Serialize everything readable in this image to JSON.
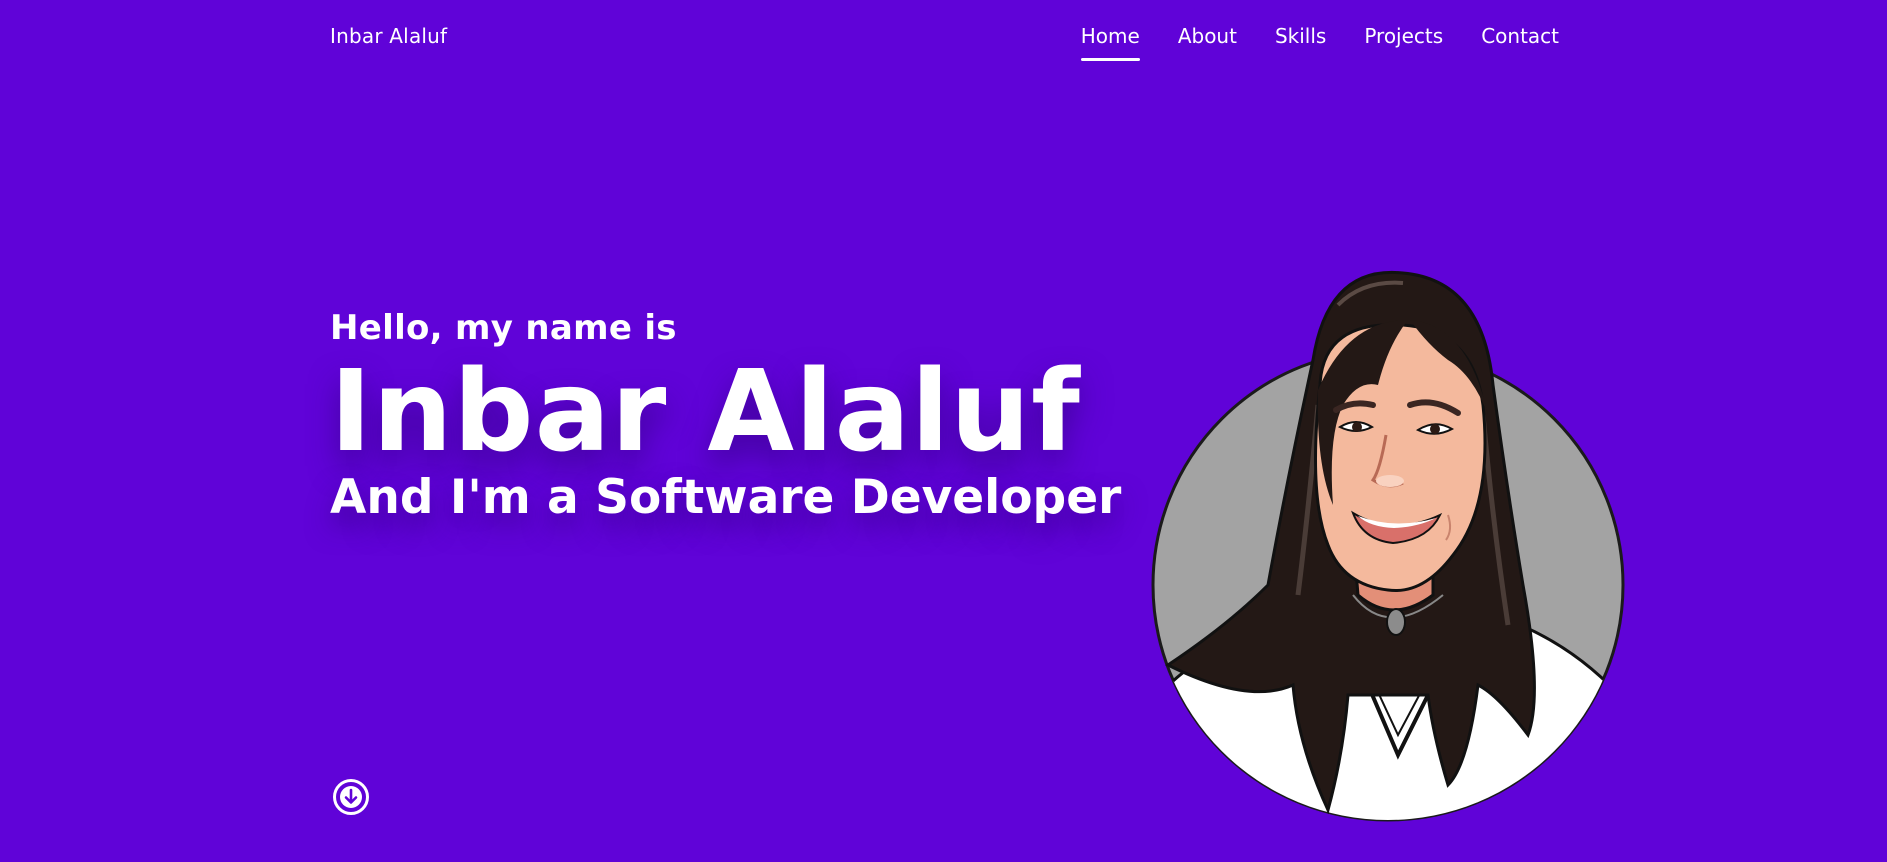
{
  "header": {
    "brand": "Inbar Alaluf",
    "nav": [
      {
        "label": "Home",
        "active": true
      },
      {
        "label": "About",
        "active": false
      },
      {
        "label": "Skills",
        "active": false
      },
      {
        "label": "Projects",
        "active": false
      },
      {
        "label": "Contact",
        "active": false
      }
    ]
  },
  "hero": {
    "greeting": "Hello, my name is",
    "name": "Inbar Alaluf",
    "role": "And I'm a Software Developer"
  },
  "icons": {
    "scroll": "arrow-down-circle-icon",
    "avatar": "cartoon-portrait"
  },
  "colors": {
    "background": "#6003d8",
    "text": "#ffffff",
    "avatar_circle": "#a3a3a3"
  }
}
